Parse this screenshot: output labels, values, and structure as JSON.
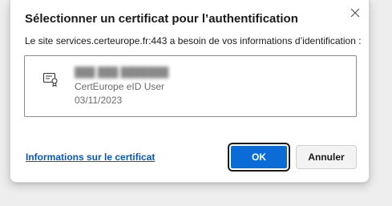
{
  "dialog": {
    "title": "Sélectionner un certificat pour l’authentification",
    "description": "Le site services.certeurope.fr:443 a besoin de vos informations d’identification :",
    "close_icon": "close-icon"
  },
  "certificate": {
    "icon": "certificate-icon",
    "name": "███ ███ ███████",
    "issuer": "CertEurope eID User",
    "date": "03/11/2023"
  },
  "footer": {
    "info_link": "Informations sur le certificat",
    "ok_label": "OK",
    "cancel_label": "Annuler"
  },
  "colors": {
    "accent": "#0b6cd8",
    "link": "#0b57b5"
  }
}
